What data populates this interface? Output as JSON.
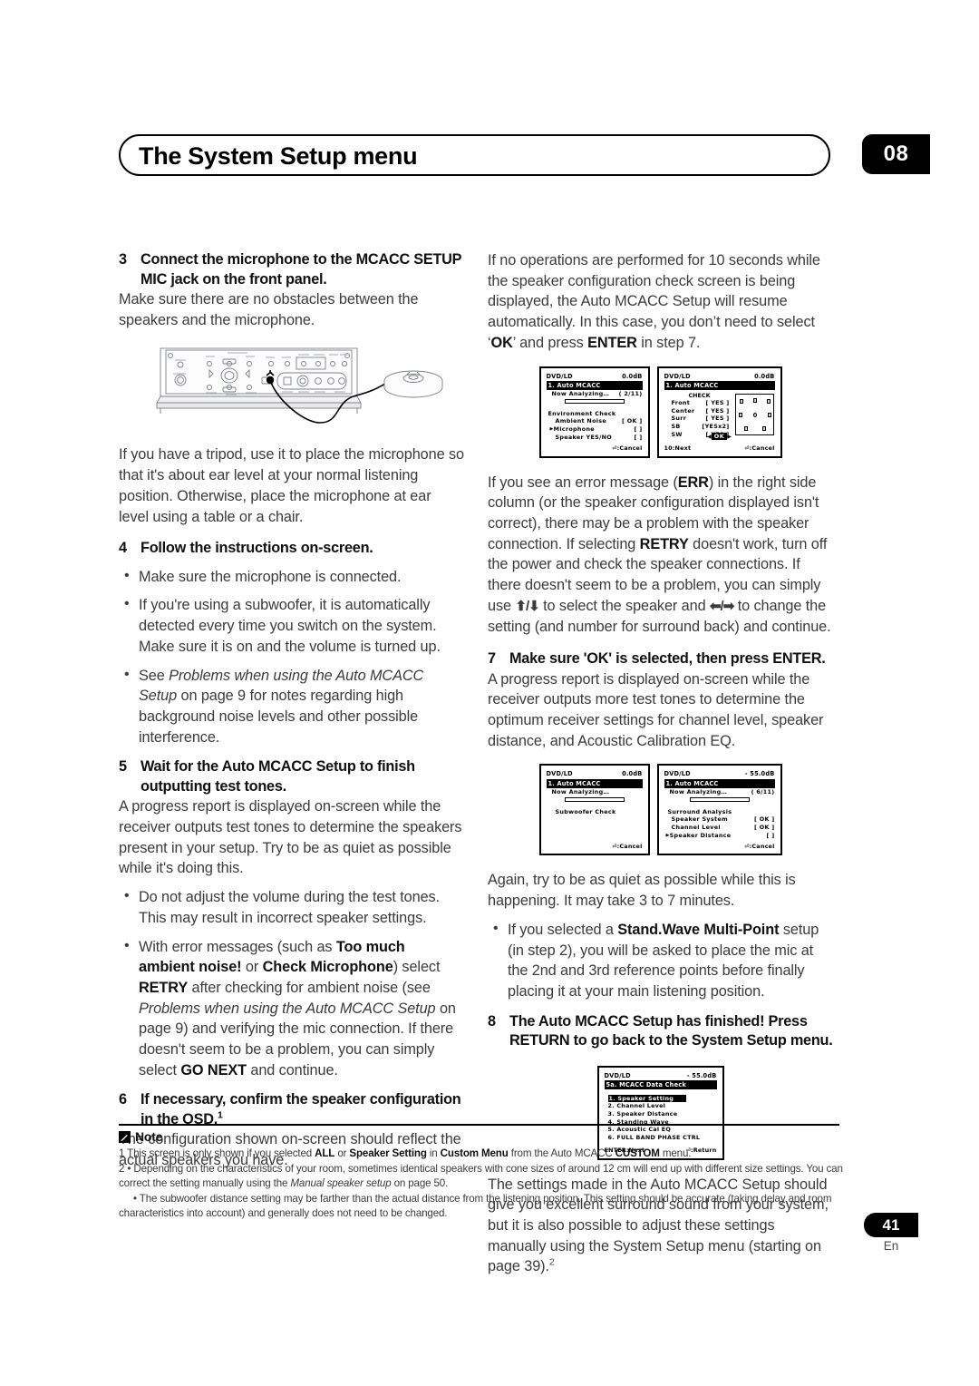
{
  "header": {
    "title": "The System Setup menu",
    "chapter": "08"
  },
  "left_column": {
    "step3": {
      "num": "3",
      "title": "Connect the microphone to the MCACC SETUP MIC jack on the front panel.",
      "body": "Make sure there are no obstacles between the speakers and the microphone."
    },
    "tripod_para": "If you have a tripod, use it to place the microphone so that it's about ear level at your normal listening position. Otherwise, place the microphone at ear level using a table or a chair.",
    "step4": {
      "num": "4",
      "title": "Follow the instructions on-screen.",
      "bullets": [
        "Make sure the microphone is connected.",
        "If you're using a subwoofer, it is automatically detected every time you switch on the system. Make sure it is on and the volume is turned up.",
        "See Problems when using the Auto MCACC Setup on page 9 for notes regarding high background noise levels and other possible interference."
      ]
    },
    "step5": {
      "num": "5",
      "title": "Wait for the Auto MCACC Setup to finish outputting test tones.",
      "body": "A progress report is displayed on-screen while the receiver outputs test tones to determine the speakers present in your setup. Try to be as quiet as possible while it's doing this."
    },
    "step5_bullets": [
      "Do not adjust the volume during the test tones. This may result in incorrect speaker settings.",
      "With error messages (such as Too much ambient noise! or Check Microphone) select RETRY after checking for ambient noise (see Problems when using the Auto MCACC Setup on page 9) and verifying the mic connection. If there doesn't seem to be a problem, you can simply select GO NEXT and continue."
    ],
    "step6": {
      "num": "6",
      "title": "If necessary, confirm the speaker configuration in the OSD.",
      "title_sup": "1",
      "body": "The configuration shown on-screen should reflect the actual speakers you have."
    }
  },
  "right_column": {
    "intro_para": "If no operations are performed for 10 seconds while the speaker configuration check screen is being displayed, the Auto MCACC Setup will resume automatically. In this case, you don't need to select 'OK' and press ENTER in step 7.",
    "err_para": "If you see an error message (ERR) in the right side column (or the speaker configuration displayed isn't correct), there may be a problem with the speaker connection. If selecting RETRY doesn't work, turn off the power and check the speaker connections. If there doesn't seem to be a problem, you can simply use ↑/↓ to select the speaker and ←/→ to change the setting (and number for surround back) and continue.",
    "step7": {
      "num": "7",
      "title": "Make sure 'OK' is selected, then press ENTER.",
      "body": "A progress report is displayed on-screen while the receiver outputs more test tones to determine the optimum receiver settings for channel level, speaker distance, and Acoustic Calibration EQ."
    },
    "again_para": "Again, try to be as quiet as possible while this is happening. It may take 3 to 7 minutes.",
    "standwave_bullet": "If you selected a Stand.Wave Multi-Point setup (in step 2), you will be asked to place the mic at the 2nd and 3rd reference points before finally placing it at your main listening position.",
    "step8": {
      "num": "8",
      "title": "The Auto MCACC Setup has finished! Press RETURN to go back to the System Setup menu."
    },
    "closing_para": "The settings made in the Auto MCACC Setup should give you excellent surround sound from your system, but it is also possible to adjust these settings manually using the System Setup menu (starting on page 39).",
    "closing_sup": "2"
  },
  "osd_screens": {
    "env_check": {
      "source": "DVD/LD",
      "level": "0.0dB",
      "title": "1. Auto MCACC",
      "status": "Now Analyzing…",
      "counter": "( 2/11)",
      "section": "Environment Check",
      "items": [
        {
          "label": "Ambient Noise",
          "value": "[ OK ]",
          "marker": ""
        },
        {
          "label": "Microphone",
          "value": "[      ]",
          "marker": "▶"
        },
        {
          "label": "Speaker YES/NO",
          "value": "[      ]",
          "marker": ""
        }
      ],
      "footer_left": "",
      "footer_right": "⏎:Cancel"
    },
    "speaker_check": {
      "source": "DVD/LD",
      "level": "0.0dB",
      "title": "1. Auto MCACC",
      "col_head": "CHECK",
      "rows": [
        {
          "label": "Front",
          "value": "[ YES ]"
        },
        {
          "label": "Center",
          "value": "[ YES ]"
        },
        {
          "label": "Surr",
          "value": "[ YES ]"
        },
        {
          "label": "SB",
          "value": "[YESx2]"
        },
        {
          "label": "SW",
          "value": "[ YES ]"
        }
      ],
      "ok_button": "OK",
      "footer_left": "10:Next",
      "footer_right": "⏎:Cancel"
    },
    "subwoofer_check": {
      "source": "DVD/LD",
      "level": "0.0dB",
      "title": "1. Auto MCACC",
      "status": "Now Analyzing…",
      "counter": "",
      "section": "Subwoofer Check",
      "footer_right": "⏎:Cancel"
    },
    "surround_analysis": {
      "source": "DVD/LD",
      "level": "- 55.0dB",
      "title": "1. Auto MCACC",
      "status": "Now  Analyzing…",
      "counter": "( 6/11)",
      "section": "Surround Analysis",
      "items": [
        {
          "label": "Speaker System",
          "value": "[ OK ]",
          "marker": ""
        },
        {
          "label": "Channel Level",
          "value": "[ OK ]",
          "marker": ""
        },
        {
          "label": "Speaker Distance",
          "value": "[     ]",
          "marker": "▶"
        }
      ],
      "footer_right": "⏎:Cancel"
    },
    "data_check": {
      "source": "DVD/LD",
      "level": "- 55.0dB",
      "title": "5a. MCACC Data Check",
      "menu": [
        "1. Speaker Setting",
        "2. Channel Level",
        "3. Speaker Distance",
        "4. Standing Wave",
        "5. Acoustic Cal EQ",
        "6. FULL BAND PHASE CTRL"
      ],
      "footer_left": "ENTER:Next",
      "footer_right": "⏎:Return"
    }
  },
  "notes": {
    "label": "Note",
    "items": [
      "1 This screen is only shown if you selected ALL or Speaker Setting in Custom Menu from the Auto MCACC CUSTOM menu.",
      "2 • Depending on the characteristics of your room, sometimes identical speakers with cone sizes of around 12 cm will end up with different size settings. You can correct the setting manually using the Manual speaker setup on page 50.",
      "• The subwoofer distance setting may be farther than the actual distance from the listening position. This setting should be accurate (taking delay and room characteristics into account) and generally does not need to be changed."
    ]
  },
  "footer": {
    "page_number": "41",
    "language": "En"
  }
}
